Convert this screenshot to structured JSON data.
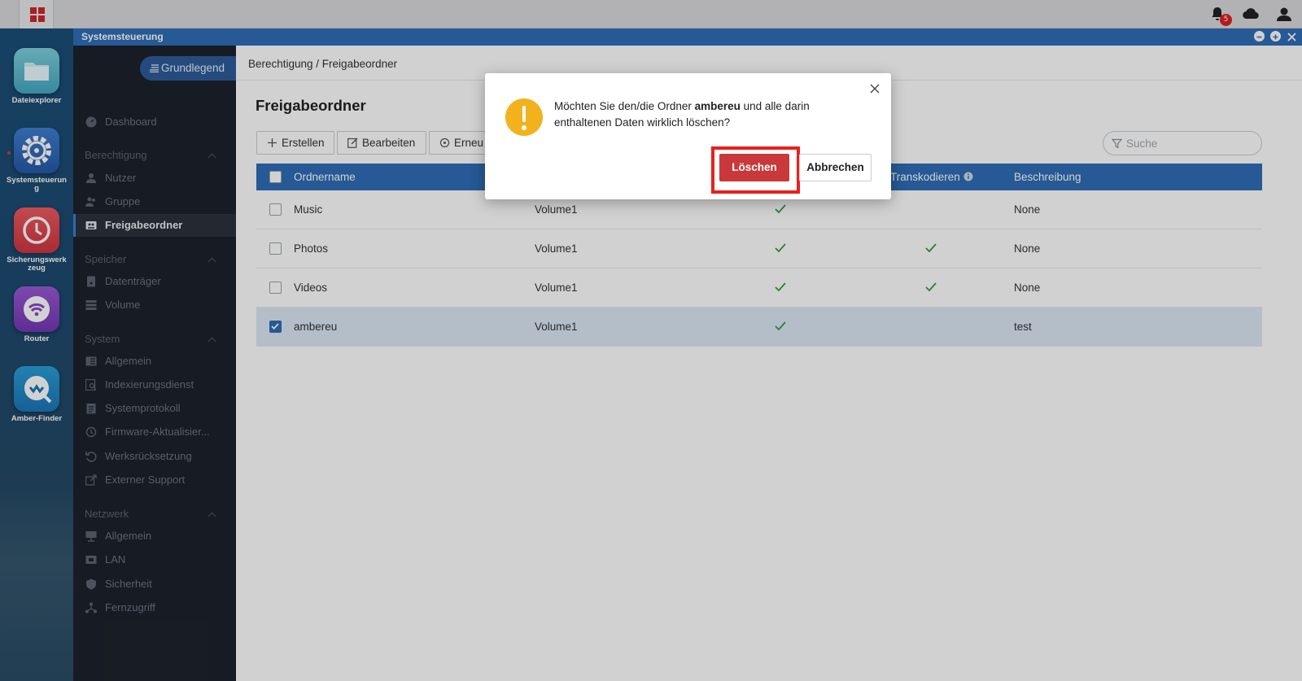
{
  "topbar": {
    "start_icon": "grid-icon",
    "notification_count": "5",
    "icons": [
      "bell-icon",
      "cloud-icon",
      "user-icon"
    ]
  },
  "dock": {
    "items": [
      {
        "label": "Dateiexplorer",
        "icon": "folder-icon"
      },
      {
        "label": "Systemsteuerung",
        "icon": "gear-icon"
      },
      {
        "label": "Sicherungswerkzeug",
        "icon": "clock-icon"
      },
      {
        "label": "Router",
        "icon": "wifi-icon"
      },
      {
        "label": "Amber-Finder",
        "icon": "finder-icon"
      }
    ]
  },
  "window": {
    "title": "Systemsteuerung"
  },
  "sidebar": {
    "mode_label": "Grundlegend",
    "dashboard": "Dashboard",
    "sections": {
      "berechtigung": "Berechtigung",
      "speicher": "Speicher",
      "system": "System",
      "netzwerk": "Netzwerk"
    },
    "items": {
      "nutzer": "Nutzer",
      "gruppe": "Gruppe",
      "freigabeordner": "Freigabeordner",
      "datentraeger": "Datenträger",
      "volume": "Volume",
      "allgemein_sys": "Allgemein",
      "indexierung": "Indexierungsdienst",
      "systemprotokoll": "Systemprotokoll",
      "firmware": "Firmware-Aktualisier...",
      "werksruecksetzung": "Werksrücksetzung",
      "externer_support": "Externer Support",
      "allgemein_net": "Allgemein",
      "lan": "LAN",
      "sicherheit": "Sicherheit",
      "fernzugriff": "Fernzugriff"
    }
  },
  "main": {
    "breadcrumb": "Berechtigung / Freigabeordner",
    "title": "Freigabeordner",
    "toolbar": {
      "create": "Erstellen",
      "edit": "Bearbeiten",
      "renew": "Erneu"
    },
    "search": {
      "placeholder": "Suche"
    },
    "table": {
      "columns": {
        "name": "Ordnername",
        "transcode": "Transkodieren",
        "description": "Beschreibung"
      },
      "rows": [
        {
          "name": "Music",
          "volume": "Volume1",
          "description": "None",
          "checked": false,
          "col3": true,
          "transcode": false
        },
        {
          "name": "Photos",
          "volume": "Volume1",
          "description": "None",
          "checked": false,
          "col3": true,
          "transcode": true
        },
        {
          "name": "Videos",
          "volume": "Volume1",
          "description": "None",
          "checked": false,
          "col3": true,
          "transcode": true
        },
        {
          "name": "ambereu",
          "volume": "Volume1",
          "description": "test",
          "checked": true,
          "col3": true,
          "transcode": false
        }
      ]
    }
  },
  "dialog": {
    "message_pre": "Möchten Sie den/die Ordner ",
    "message_bold": "ambereu",
    "message_post": " und alle darin enthaltenen Daten wirklich löschen?",
    "delete_label": "Löschen",
    "cancel_label": "Abbrechen",
    "icon": "warning-icon"
  },
  "colors": {
    "accent": "#2f6db6",
    "delete": "#c9383a",
    "warning": "#f2b21e",
    "highlight": "#e8201c",
    "check": "#3a9a3a"
  }
}
